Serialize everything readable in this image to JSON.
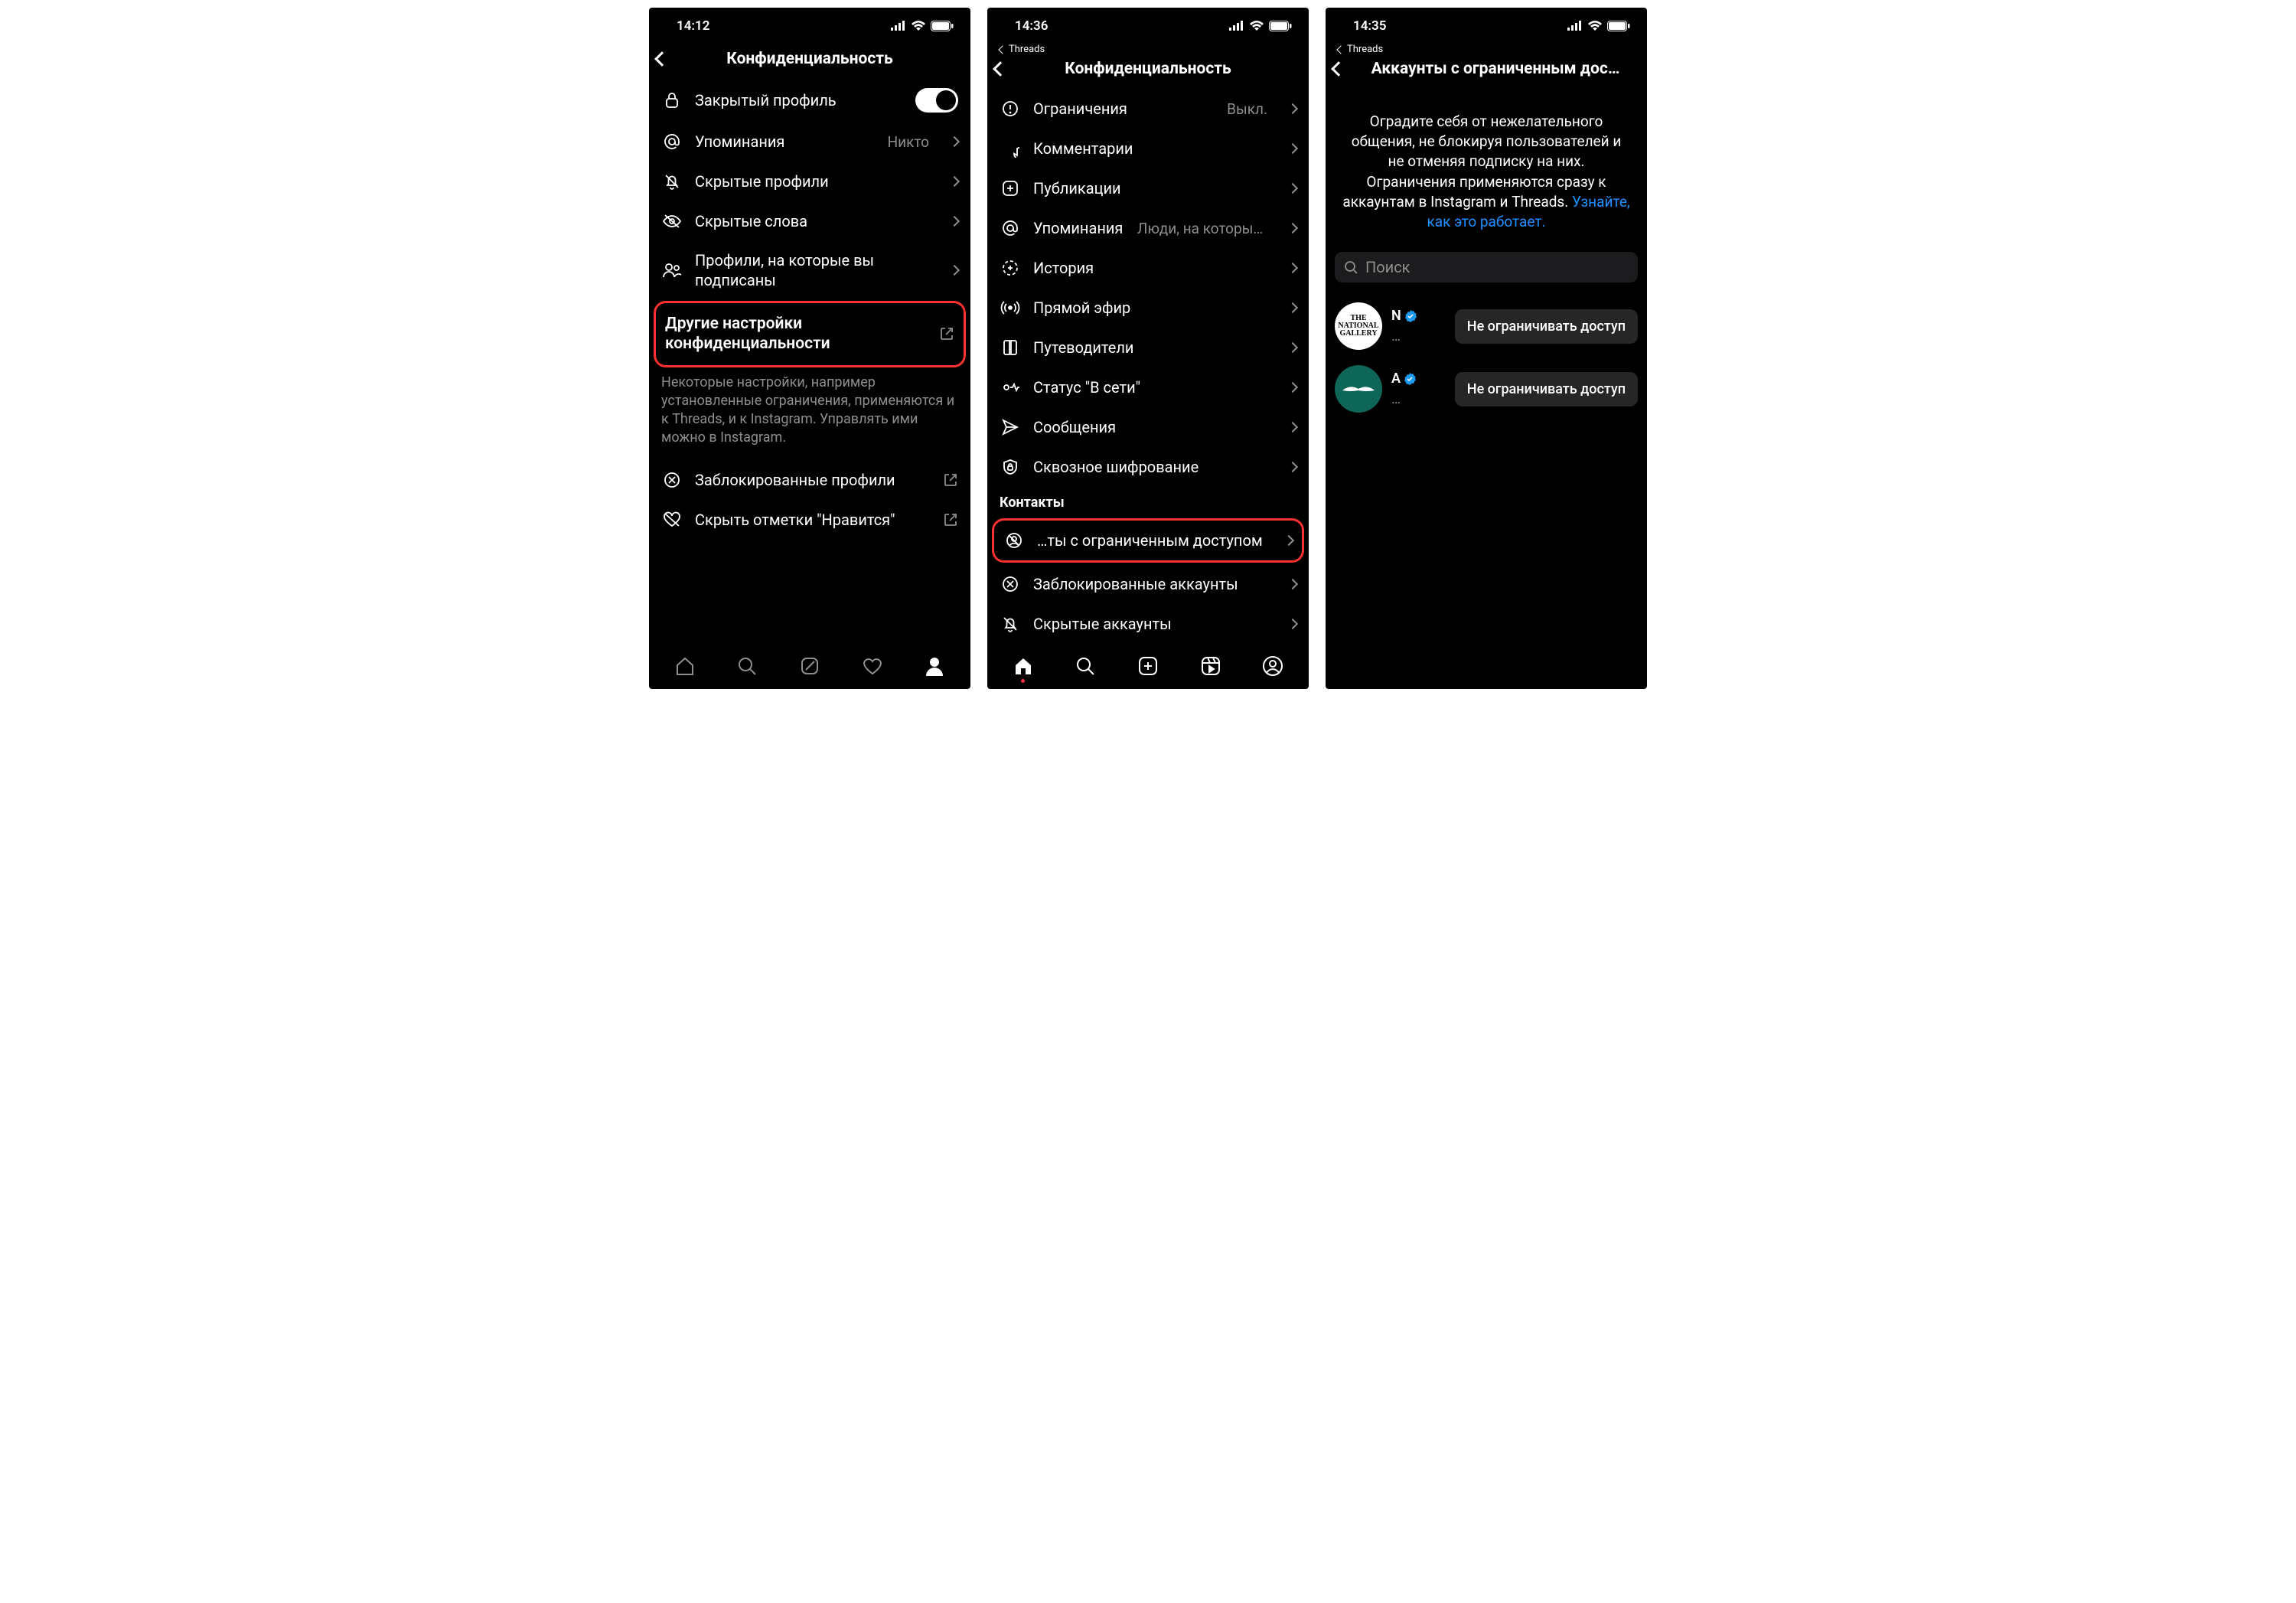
{
  "screen1": {
    "status": {
      "time": "14:12"
    },
    "title": "Конфиденциальность",
    "rows": {
      "private": "Закрытый профиль",
      "mentions": {
        "label": "Упоминания",
        "value": "Никто"
      },
      "muted": "Скрытые профили",
      "hidden_words": "Скрытые слова",
      "following": "Профили, на которые вы подписаны"
    },
    "other_settings": "Другие настройки конфиденциальности",
    "footnote": "Некоторые настройки, например установленные ограничения, применяются и к Threads, и к Instagram. Управлять ими можно в Instagram.",
    "blocked": "Заблокированные профили",
    "hide_likes": "Скрыть отметки \"Нравится\""
  },
  "screen2": {
    "status": {
      "time": "14:36"
    },
    "breadcrumb": "Threads",
    "title": "Конфиденциальность",
    "rows": {
      "limits": {
        "label": "Ограничения",
        "value": "Выкл."
      },
      "comments": "Комментарии",
      "posts": "Публикации",
      "mentions": {
        "label": "Упоминания",
        "value": "Люди, на которых вы подписаны"
      },
      "story": "История",
      "live": "Прямой эфир",
      "guides": "Путеводители",
      "activity": "Статус \"В сети\"",
      "messages": "Сообщения",
      "e2ee": "Сквозное шифрование"
    },
    "contacts_header": "Контакты",
    "restricted": "…ты с ограниченным доступом",
    "blocked": "Заблокированные аккаунты",
    "muted": "Скрытые аккаунты"
  },
  "screen3": {
    "status": {
      "time": "14:35"
    },
    "breadcrumb": "Threads",
    "title": "Аккаунты с ограниченным дос…",
    "desc": "Оградите себя от нежелательного общения, не блокируя пользователей и не отменяя подписку на них. Ограничения применяются сразу к аккаунтам в Instagram и Threads.",
    "learn_more": "Узнайте, как это работает.",
    "search_placeholder": "Поиск",
    "accounts": [
      {
        "avatar_label": "THE NATIONAL GALLERY",
        "initial": "N",
        "button": "Не ограничивать доступ"
      },
      {
        "avatar_label": "",
        "initial": "A",
        "button": "Не ограничивать доступ"
      }
    ]
  }
}
